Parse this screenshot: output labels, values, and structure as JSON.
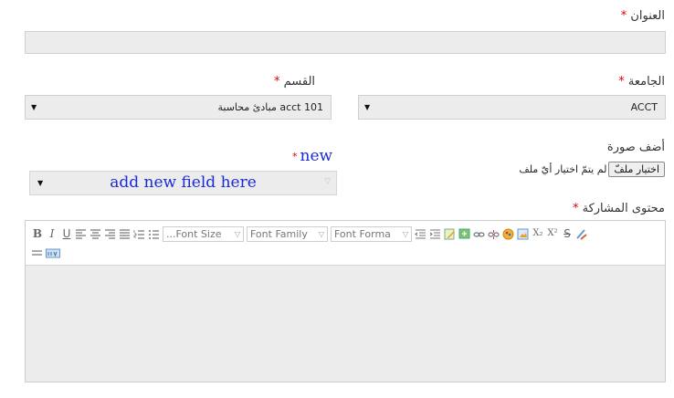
{
  "title_field": {
    "label": "العنوان",
    "required": "*",
    "value": ""
  },
  "university_field": {
    "label": "الجامعة",
    "required": "*",
    "selected": "ACCT"
  },
  "department_field": {
    "label": "القسم",
    "required": "*",
    "selected": "acct 101 مبادئ محاسبة"
  },
  "image_field": {
    "label": "أضف صورة",
    "button": "اختيار ملفّ",
    "status": "لم يتمّ اختيار أيّ ملف"
  },
  "new_field": {
    "required": "*",
    "label": "new",
    "placeholder": "add new field here"
  },
  "content_field": {
    "label": "محتوى المشاركة",
    "required": "*"
  },
  "toolbar": {
    "font_size": "...Font Size",
    "font_family": "Font Family",
    "font_format": "Font Forma",
    "bold": "B",
    "italic": "I",
    "underline": "U",
    "strike": "S",
    "subscript": "X₂",
    "superscript": "X²"
  },
  "icons": {
    "select_arrow": "▼",
    "drop_arrow": "▽"
  }
}
